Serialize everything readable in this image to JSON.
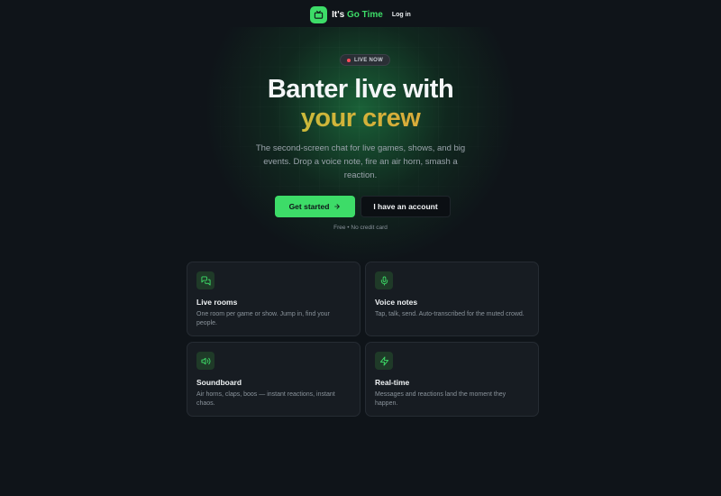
{
  "nav": {
    "brand_a": "It's",
    "brand_b": "Go Time",
    "login": "Log in",
    "logo_icon": "tv-icon"
  },
  "hero": {
    "badge": "LIVE NOW",
    "title_line1": "Banter live with",
    "title_line2": "your crew",
    "subtitle": "The second-screen chat for live games, shows, and big events. Drop a voice note, fire an air horn, smash a reaction.",
    "primary_button": "Get started",
    "primary_button_icon": "arrow-right-icon",
    "secondary_button": "I have an account",
    "fine_print": "Free • No credit card"
  },
  "features": [
    {
      "title": "Live rooms",
      "description": "One room per game or show. Jump in, find your people.",
      "icon": "chat-bubbles-icon"
    },
    {
      "title": "Voice notes",
      "description": "Tap, talk, send. Auto-transcribed for the muted crowd.",
      "icon": "microphone-icon"
    },
    {
      "title": "Soundboard",
      "description": "Air horns, claps, boos — instant reactions, instant chaos.",
      "icon": "speaker-icon"
    },
    {
      "title": "Real-time",
      "description": "Messages and reactions land the moment they happen.",
      "icon": "lightning-icon"
    }
  ],
  "colors": {
    "background": "#0f1419",
    "accent": "#3ddc68",
    "card": "#171c22",
    "live_dot": "#ff4d5a"
  }
}
